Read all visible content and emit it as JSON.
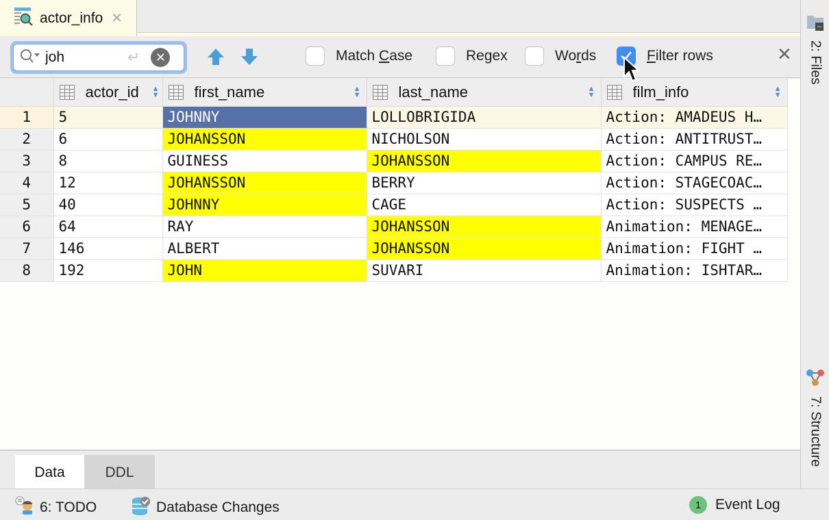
{
  "editor_tab": {
    "title": "actor_info",
    "icon": "table-view-icon",
    "close_icon": "close-icon"
  },
  "find_bar": {
    "query": "joh",
    "placeholder": "",
    "search_icon": "search-history-icon",
    "enter_icon": "enter-icon",
    "clear_icon": "clear-icon",
    "prev_icon": "arrow-up-icon",
    "next_icon": "arrow-down-icon",
    "options": [
      {
        "label": "Match Case",
        "mnemonic_index": 6,
        "checked": false
      },
      {
        "label": "Regex",
        "mnemonic_index": 2,
        "checked": false
      },
      {
        "label": "Words",
        "mnemonic_index": 2,
        "checked": false
      },
      {
        "label": "Filter rows",
        "mnemonic_index": 0,
        "checked": true
      }
    ],
    "close_icon": "close-icon"
  },
  "grid": {
    "columns": [
      {
        "name": "actor_id"
      },
      {
        "name": "first_name"
      },
      {
        "name": "last_name"
      },
      {
        "name": "film_info"
      }
    ],
    "rows": [
      {
        "num": "1",
        "actor_id": "5",
        "first_name": "JOHNNY",
        "last_name": "LOLLOBRIGIDA",
        "film_info": "Action: AMADEUS H…",
        "hl_first": true,
        "hl_last": false,
        "selected_cell": "first_name",
        "current": true
      },
      {
        "num": "2",
        "actor_id": "6",
        "first_name": "JOHANSSON",
        "last_name": "NICHOLSON",
        "film_info": "Action: ANTITRUST…",
        "hl_first": true,
        "hl_last": false
      },
      {
        "num": "3",
        "actor_id": "8",
        "first_name": "GUINESS",
        "last_name": "JOHANSSON",
        "film_info": "Action: CAMPUS RE…",
        "hl_first": false,
        "hl_last": true
      },
      {
        "num": "4",
        "actor_id": "12",
        "first_name": "JOHANSSON",
        "last_name": "BERRY",
        "film_info": "Action: STAGECOAC…",
        "hl_first": true,
        "hl_last": false
      },
      {
        "num": "5",
        "actor_id": "40",
        "first_name": "JOHNNY",
        "last_name": "CAGE",
        "film_info": "Action: SUSPECTS …",
        "hl_first": true,
        "hl_last": false
      },
      {
        "num": "6",
        "actor_id": "64",
        "first_name": "RAY",
        "last_name": "JOHANSSON",
        "film_info": "Animation: MENAGE…",
        "hl_first": false,
        "hl_last": true
      },
      {
        "num": "7",
        "actor_id": "146",
        "first_name": "ALBERT",
        "last_name": "JOHANSSON",
        "film_info": "Animation: FIGHT …",
        "hl_first": false,
        "hl_last": true
      },
      {
        "num": "8",
        "actor_id": "192",
        "first_name": "JOHN",
        "last_name": "SUVARI",
        "film_info": "Animation: ISHTAR…",
        "hl_first": true,
        "hl_last": false
      }
    ],
    "colors": {
      "match_highlight": "#ffff00",
      "selection": "#5670a8",
      "current_row": "#fcf8e6"
    }
  },
  "bottom_tabs": [
    {
      "label": "Data",
      "active": true
    },
    {
      "label": "DDL",
      "active": false
    }
  ],
  "right_tools": [
    {
      "label": "2: Files",
      "icon": "folder-icon"
    },
    {
      "label": "7: Structure",
      "icon": "structure-icon"
    }
  ],
  "status_bar": {
    "todo": {
      "label": "6: TODO",
      "icon": "todo-icon"
    },
    "db_changes": {
      "label": "Database Changes",
      "icon": "database-icon"
    },
    "event_log": {
      "label": "Event Log",
      "count": "1",
      "icon": "event-log-icon"
    }
  }
}
